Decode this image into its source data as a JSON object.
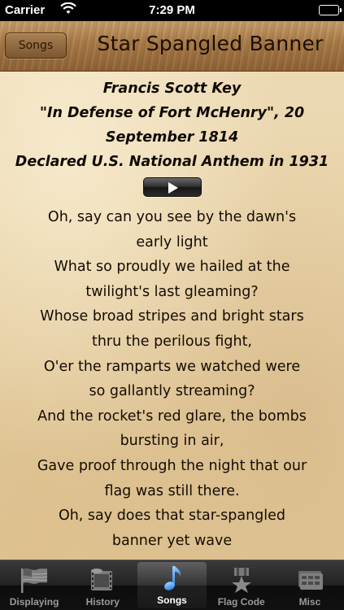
{
  "status_bar": {
    "carrier": "Carrier",
    "time": "7:29 PM",
    "icons": [
      "wifi-icon",
      "battery-icon"
    ]
  },
  "nav": {
    "back_label": "Songs",
    "title": "Star Spangled Banner"
  },
  "credits": [
    "Francis Scott Key",
    "\"In Defense of Fort McHenry\", 20",
    "September 1814",
    "Declared U.S. National Anthem in 1931"
  ],
  "player": {
    "icon": "play-icon"
  },
  "lyrics": [
    "Oh, say can you see by the dawn's",
    "early light",
    "What so proudly we hailed at the",
    "twilight's last gleaming?",
    "Whose broad stripes and bright stars",
    "thru the perilous fight,",
    "O'er the ramparts we watched were",
    "so gallantly streaming?",
    "And the rocket's red glare, the bombs",
    "bursting in air,",
    "Gave proof through the night that our",
    "flag was still there.",
    "Oh, say does that star-spangled",
    "banner yet wave"
  ],
  "tabs": [
    {
      "label": "Displaying",
      "icon": "flag-icon",
      "selected": false
    },
    {
      "label": "History",
      "icon": "film-strip-icon",
      "selected": false
    },
    {
      "label": "Songs",
      "icon": "music-note-icon",
      "selected": true
    },
    {
      "label": "Flag Code",
      "icon": "star-ribbon-icon",
      "selected": false
    },
    {
      "label": "Misc",
      "icon": "folder-icon",
      "selected": false
    }
  ],
  "colors": {
    "selected_tab_icon": "#4fa3f7",
    "parchment": "#e8d2a8",
    "nav_leather": "#a87a48"
  }
}
